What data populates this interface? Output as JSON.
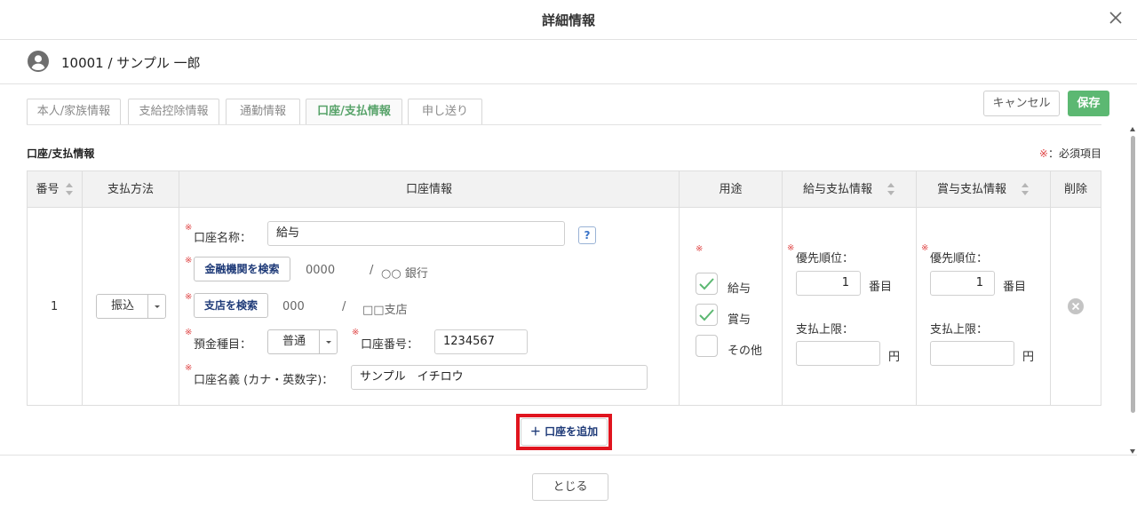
{
  "header": {
    "title": "詳細情報"
  },
  "user": {
    "name": "10001 / サンプル 一郎"
  },
  "tabs": [
    {
      "label": "本人/家族情報",
      "active": false
    },
    {
      "label": "支給控除情報",
      "active": false
    },
    {
      "label": "通勤情報",
      "active": false
    },
    {
      "label": "口座/支払情報",
      "active": true
    },
    {
      "label": "申し送り",
      "active": false
    }
  ],
  "actions": {
    "cancel": "キャンセル",
    "save": "保存"
  },
  "section": {
    "title": "口座/支払情報",
    "required_mark": "※",
    "required_text": "：必須項目"
  },
  "table": {
    "columns": [
      "番号",
      "支払方法",
      "口座情報",
      "用途",
      "給与支払情報",
      "賞与支払情報",
      "削除"
    ],
    "row": {
      "number": "1",
      "payment_method": "振込",
      "account": {
        "name_label": "口座名称：",
        "name_value": "給与",
        "help": "?",
        "bank_search": "金融機関を検索",
        "bank_code": "0000",
        "bank_sep": "/",
        "bank_name": "○○ 銀行",
        "branch_search": "支店を検索",
        "branch_code": "000",
        "branch_sep": "/",
        "branch_name": "□□支店",
        "deposit_type_label": "預金種目：",
        "deposit_type_value": "普通",
        "account_number_label": "口座番号：",
        "account_number_value": "1234567",
        "holder_label": "口座名義 (カナ・英数字)：",
        "holder_value": "サンプル　イチロウ"
      },
      "usage": [
        {
          "label": "給与",
          "checked": true
        },
        {
          "label": "賞与",
          "checked": true
        },
        {
          "label": "その他",
          "checked": false
        }
      ],
      "salary": {
        "priority_label": "優先順位：",
        "priority_value": "1",
        "priority_unit": "番目",
        "limit_label": "支払上限：",
        "limit_value": "",
        "limit_unit": "円"
      },
      "bonus": {
        "priority_label": "優先順位：",
        "priority_value": "1",
        "priority_unit": "番目",
        "limit_label": "支払上限：",
        "limit_value": "",
        "limit_unit": "円"
      }
    }
  },
  "add_account": "＋ 口座を追加",
  "footer": {
    "close": "とじる"
  },
  "colors": {
    "accent_green": "#5cb872",
    "required_red": "#e04848",
    "button_navy": "#1e3a78",
    "highlight_red": "#e0141e"
  }
}
